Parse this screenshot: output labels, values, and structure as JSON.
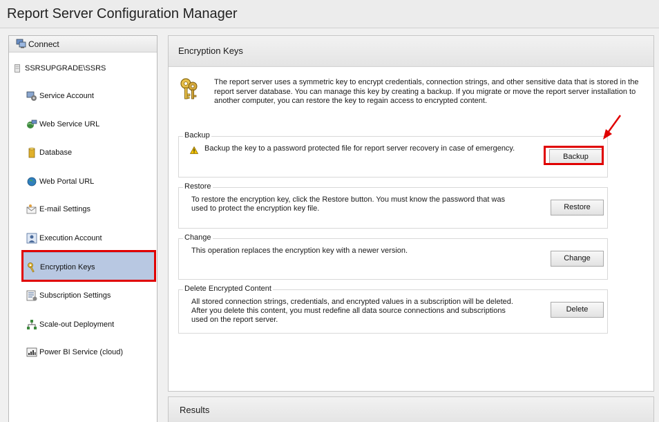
{
  "window": {
    "title": "Report Server Configuration Manager"
  },
  "sidebar": {
    "connect_label": "Connect",
    "server_name": "SSRSUPGRADE\\SSRS",
    "items": [
      {
        "label": "Service Account",
        "icon": "service-account-icon"
      },
      {
        "label": "Web Service URL",
        "icon": "web-service-url-icon"
      },
      {
        "label": "Database",
        "icon": "database-icon"
      },
      {
        "label": "Web Portal URL",
        "icon": "globe-icon"
      },
      {
        "label": "E-mail Settings",
        "icon": "email-icon"
      },
      {
        "label": "Execution Account",
        "icon": "execution-account-icon"
      },
      {
        "label": "Encryption Keys",
        "icon": "key-icon",
        "selected": true
      },
      {
        "label": "Subscription Settings",
        "icon": "subscription-icon"
      },
      {
        "label": "Scale-out Deployment",
        "icon": "scale-out-icon"
      },
      {
        "label": "Power BI Service (cloud)",
        "icon": "power-bi-icon"
      }
    ]
  },
  "main": {
    "title": "Encryption Keys",
    "intro": "The report server uses a symmetric key to encrypt credentials, connection strings, and other sensitive data that is stored in the report server database.  You can manage this key by creating a backup.  If you migrate or move the report server installation to another computer, you can restore the key to regain access to encrypted content.",
    "groups": {
      "backup": {
        "title": "Backup",
        "text": "Backup the key to a password protected file for report server recovery in case of emergency.",
        "button": "Backup"
      },
      "restore": {
        "title": "Restore",
        "text": "To restore the encryption key, click the Restore button.  You must know the password that was used to protect the encryption key file.",
        "button": "Restore"
      },
      "change": {
        "title": "Change",
        "text": "This operation replaces the encryption key with a newer version.",
        "button": "Change"
      },
      "delete": {
        "title": "Delete Encrypted Content",
        "text": "All stored connection strings, credentials, and encrypted values in a subscription will be deleted.  After you delete this content, you must redefine all data source connections and subscriptions used on the report server.",
        "button": "Delete"
      }
    }
  },
  "results": {
    "title": "Results"
  },
  "colors": {
    "highlight_red": "#e00000",
    "selected_bg": "#b8c8e2"
  }
}
